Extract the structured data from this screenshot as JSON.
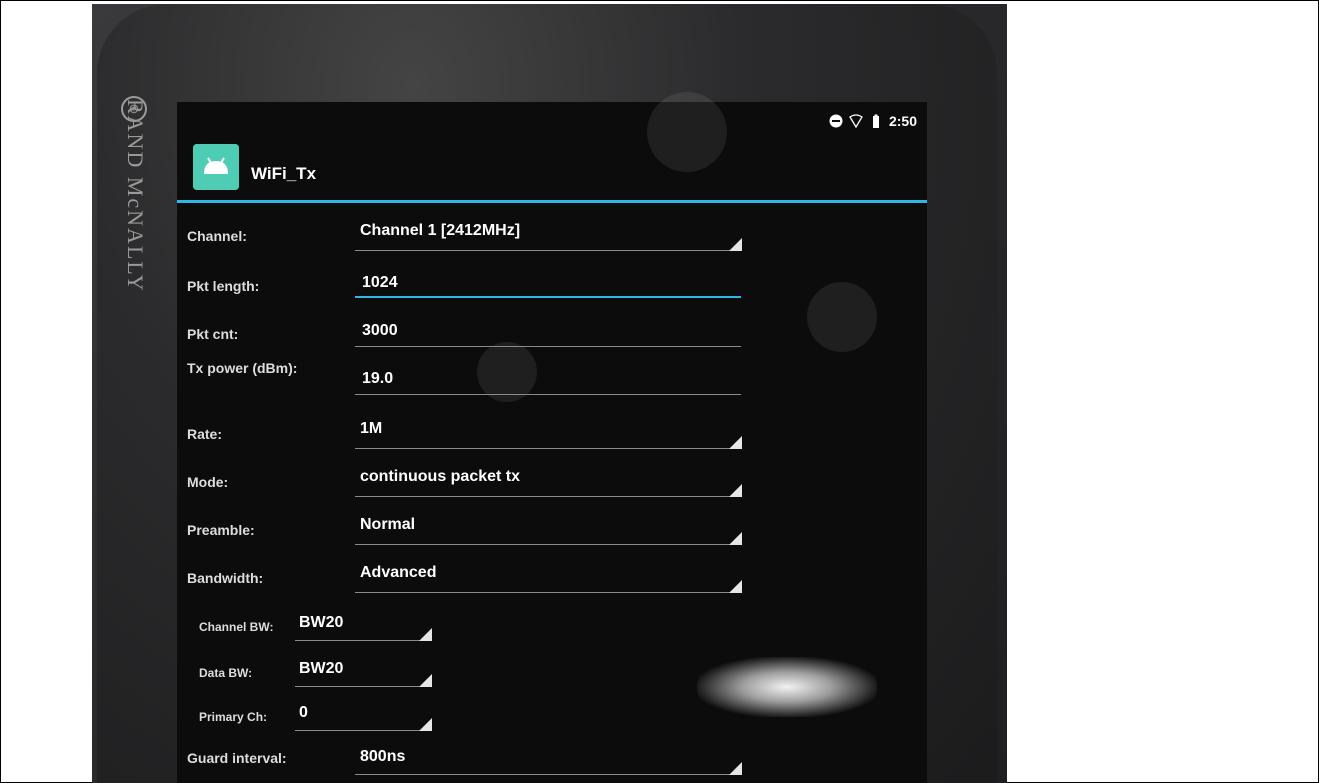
{
  "brand": {
    "name": "RAND McNALLY"
  },
  "status": {
    "time": "2:50",
    "icons": [
      "do-not-disturb-icon",
      "wifi-icon",
      "battery-icon"
    ]
  },
  "app": {
    "title": "WiFi_Tx",
    "icon": "android-icon"
  },
  "form": {
    "channel": {
      "label": "Channel:",
      "value": "Channel 1 [2412MHz]"
    },
    "pkt_length": {
      "label": "Pkt length:",
      "value": "1024"
    },
    "pkt_cnt": {
      "label": "Pkt cnt:",
      "value": "3000"
    },
    "tx_power": {
      "label": "Tx power (dBm):",
      "value": "19.0"
    },
    "rate": {
      "label": "Rate:",
      "value": "1M"
    },
    "mode": {
      "label": "Mode:",
      "value": "continuous packet tx"
    },
    "preamble": {
      "label": "Preamble:",
      "value": "Normal"
    },
    "bandwidth": {
      "label": "Bandwidth:",
      "value": "Advanced"
    },
    "channel_bw": {
      "label": "Channel BW:",
      "value": "BW20"
    },
    "data_bw": {
      "label": "Data BW:",
      "value": "BW20"
    },
    "primary_ch": {
      "label": "Primary Ch:",
      "value": "0"
    },
    "guard_interval": {
      "label": "Guard interval:",
      "value": "800ns"
    }
  },
  "colors": {
    "accent": "#33b5e5",
    "app_icon": "#4fcdb4",
    "background": "#0c0c0d"
  }
}
